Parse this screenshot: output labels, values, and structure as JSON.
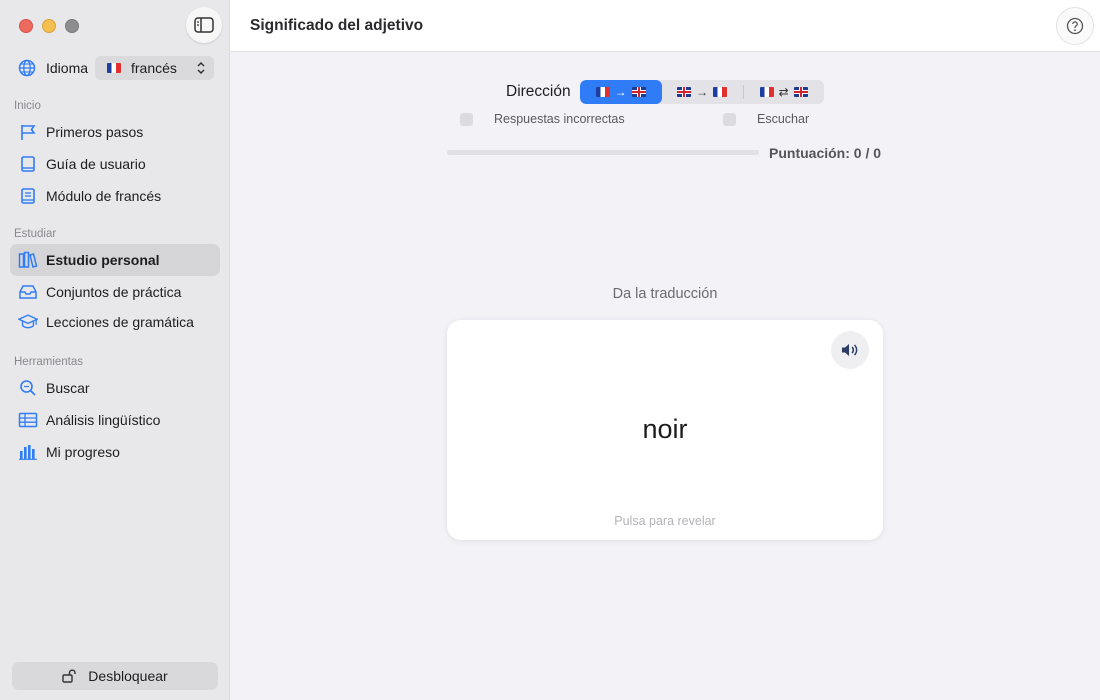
{
  "sidebar": {
    "language": {
      "label": "Idioma",
      "selected": "francés"
    },
    "sections": [
      {
        "title": "Inicio",
        "items": [
          {
            "label": "Primeros pasos",
            "icon": "flag-icon"
          },
          {
            "label": "Guía de usuario",
            "icon": "book-icon"
          },
          {
            "label": "Módulo de francés",
            "icon": "book-closed-icon"
          }
        ]
      },
      {
        "title": "Estudiar",
        "items": [
          {
            "label": "Estudio personal",
            "icon": "books-icon",
            "active": true
          },
          {
            "label": "Conjuntos de práctica",
            "icon": "tray-icon"
          },
          {
            "label": "Lecciones de gramática",
            "icon": "graduation-cap-icon"
          }
        ]
      },
      {
        "title": "Herramientas",
        "items": [
          {
            "label": "Buscar",
            "icon": "magnifier-icon"
          },
          {
            "label": "Análisis lingüístico",
            "icon": "table-icon"
          },
          {
            "label": "Mi progreso",
            "icon": "bar-chart-icon"
          }
        ]
      }
    ],
    "unlock_label": "Desbloquear"
  },
  "header": {
    "title": "Significado del adjetivo"
  },
  "quiz": {
    "direction_label": "Dirección",
    "directions": [
      "fr-to-en",
      "en-to-fr",
      "fr-en-both"
    ],
    "selected_direction": 0,
    "wrong_answers_label": "Respuestas incorrectas",
    "listen_label": "Escuchar",
    "wrong_answers_checked": false,
    "listen_checked": false,
    "progress": 0,
    "score": "Puntuación: 0 / 0",
    "prompt": "Da la traducción",
    "word": "noir",
    "reveal_hint": "Pulsa para revelar"
  },
  "colors": {
    "accent": "#2f7cf6",
    "sidebar_bg": "#e8e8ea",
    "main_bg": "#f2f2f7"
  }
}
